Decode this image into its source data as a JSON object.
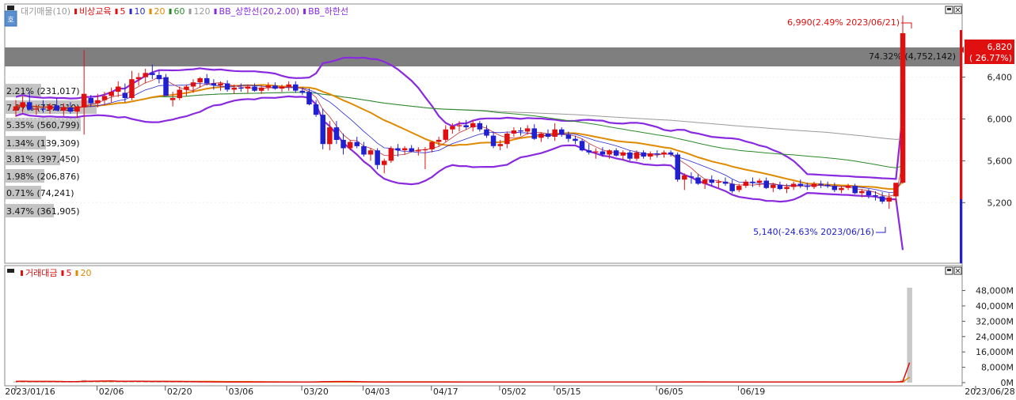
{
  "legend": {
    "top": [
      {
        "text": "대기매물(10)",
        "color": "#9a9a9a"
      },
      {
        "text": "비상교육",
        "color": "#e01010",
        "square": true
      },
      {
        "text": "5",
        "color": "#e01010",
        "square": true
      },
      {
        "text": "10",
        "color": "#2a2ad8",
        "square": true
      },
      {
        "text": "20",
        "color": "#e08a00",
        "square": true
      },
      {
        "text": "60",
        "color": "#2a8a2a",
        "square": true
      },
      {
        "text": "120",
        "color": "#9a9a9a",
        "square": true
      },
      {
        "text": "BB_상한선(20,2.00)",
        "color": "#8a2ae0",
        "square": true
      },
      {
        "text": "BB_하한선",
        "color": "#8a2ae0",
        "square": true
      }
    ],
    "bottom": [
      {
        "text": "거래대금",
        "color": "#e01010",
        "square": true
      },
      {
        "text": "5",
        "color": "#e01010",
        "square": true
      },
      {
        "text": "20",
        "color": "#e08a00",
        "square": true
      }
    ]
  },
  "main_axis": {
    "ticks": [
      "6,400",
      "6,000",
      "5,600",
      "5,200"
    ],
    "ymin": 4620,
    "ymax": 7100,
    "current_price": "6,820",
    "current_change": "( 26.77%)"
  },
  "volume_axis": {
    "ticks": [
      "48,000M",
      "40,000M",
      "32,000M",
      "24,000M",
      "16,000M",
      "8,000M",
      "0M"
    ],
    "ymax": 54000
  },
  "x_ticks": [
    "2023/01/16",
    "02/06",
    "02/20",
    "03/06",
    "03/20",
    "04/03",
    "04/17",
    "05/02",
    "05/15",
    "06/05",
    "06/19",
    "2023/06/28"
  ],
  "annotations": {
    "high": "6,990(2.49% 2023/06/21)",
    "low": "5,140(-24.63% 2023/06/16)",
    "band_label": "74.32% (4,752,142)"
  },
  "volume_profile": [
    {
      "label": "2.21% (231,017)"
    },
    {
      "label": "7.07% (737,210)"
    },
    {
      "label": "5.35% (560,799)"
    },
    {
      "label": "1.34% (139,309)"
    },
    {
      "label": "3.81% (397,450)"
    },
    {
      "label": "1.98% (206,876)"
    },
    {
      "label": "0.71% (74,241)"
    },
    {
      "label": "3.47% (361,905)"
    }
  ],
  "chart_data": {
    "type": "candlestick",
    "title": "비상교육",
    "ylim": [
      4620,
      7100
    ],
    "current": 6820,
    "high_point": {
      "value": 6990,
      "date": "2023/06/21"
    },
    "low_point": {
      "value": 5140,
      "date": "2023/06/16"
    },
    "candles": [
      [
        6080,
        6180,
        6020,
        6120
      ],
      [
        6110,
        6220,
        6060,
        6160
      ],
      [
        6160,
        6260,
        6080,
        6090
      ],
      [
        6090,
        6140,
        6040,
        6100
      ],
      [
        6100,
        6180,
        6060,
        6090
      ],
      [
        6090,
        6150,
        6050,
        6130
      ],
      [
        6130,
        6200,
        6080,
        6080
      ],
      [
        6080,
        6150,
        6030,
        6110
      ],
      [
        6110,
        6160,
        6050,
        6070
      ],
      [
        6070,
        6120,
        6010,
        6120
      ],
      [
        6110,
        6660,
        5850,
        6240
      ],
      [
        6200,
        6230,
        6120,
        6150
      ],
      [
        6150,
        6240,
        6110,
        6180
      ],
      [
        6180,
        6260,
        6130,
        6220
      ],
      [
        6220,
        6300,
        6160,
        6260
      ],
      [
        6260,
        6360,
        6210,
        6310
      ],
      [
        6250,
        6340,
        6160,
        6200
      ],
      [
        6200,
        6460,
        6180,
        6380
      ],
      [
        6380,
        6440,
        6320,
        6400
      ],
      [
        6400,
        6480,
        6340,
        6440
      ],
      [
        6440,
        6520,
        6380,
        6420
      ],
      [
        6420,
        6460,
        6340,
        6380
      ],
      [
        6400,
        6430,
        6220,
        6220
      ],
      [
        6180,
        6260,
        6120,
        6200
      ],
      [
        6200,
        6310,
        6180,
        6280
      ],
      [
        6280,
        6330,
        6220,
        6310
      ],
      [
        6310,
        6380,
        6250,
        6350
      ],
      [
        6350,
        6400,
        6300,
        6390
      ],
      [
        6390,
        6430,
        6320,
        6340
      ],
      [
        6340,
        6380,
        6280,
        6320
      ],
      [
        6320,
        6360,
        6270,
        6340
      ],
      [
        6340,
        6370,
        6260,
        6280
      ],
      [
        6280,
        6330,
        6240,
        6300
      ],
      [
        6300,
        6340,
        6260,
        6290
      ],
      [
        6290,
        6330,
        6250,
        6310
      ],
      [
        6310,
        6340,
        6260,
        6270
      ],
      [
        6270,
        6320,
        6240,
        6300
      ],
      [
        6300,
        6350,
        6270,
        6320
      ],
      [
        6320,
        6350,
        6280,
        6290
      ],
      [
        6290,
        6330,
        6260,
        6310
      ],
      [
        6310,
        6360,
        6270,
        6330
      ],
      [
        6330,
        6360,
        6250,
        6270
      ],
      [
        6270,
        6300,
        6230,
        6250
      ],
      [
        6260,
        6290,
        6130,
        6140
      ],
      [
        6140,
        6180,
        6020,
        6040
      ],
      [
        6040,
        6100,
        5710,
        5760
      ],
      [
        5760,
        5980,
        5700,
        5920
      ],
      [
        5920,
        5980,
        5760,
        5800
      ],
      [
        5800,
        5860,
        5660,
        5720
      ],
      [
        5720,
        5800,
        5700,
        5780
      ],
      [
        5780,
        5830,
        5720,
        5740
      ],
      [
        5740,
        5780,
        5640,
        5660
      ],
      [
        5660,
        5720,
        5600,
        5700
      ],
      [
        5700,
        5720,
        5520,
        5560
      ],
      [
        5560,
        5620,
        5480,
        5600
      ],
      [
        5600,
        5740,
        5580,
        5720
      ],
      [
        5720,
        5760,
        5640,
        5700
      ],
      [
        5700,
        5740,
        5660,
        5720
      ],
      [
        5720,
        5750,
        5680,
        5690
      ],
      [
        5690,
        5730,
        5650,
        5700
      ],
      [
        5700,
        5730,
        5520,
        5710
      ],
      [
        5710,
        5790,
        5680,
        5780
      ],
      [
        5780,
        5830,
        5740,
        5800
      ],
      [
        5800,
        5940,
        5780,
        5900
      ],
      [
        5900,
        5960,
        5860,
        5930
      ],
      [
        5930,
        5980,
        5880,
        5940
      ],
      [
        5940,
        5990,
        5900,
        5920
      ],
      [
        5920,
        5990,
        5880,
        5960
      ],
      [
        5960,
        5980,
        5880,
        5900
      ],
      [
        5900,
        5940,
        5820,
        5840
      ],
      [
        5840,
        5880,
        5720,
        5740
      ],
      [
        5740,
        5800,
        5700,
        5760
      ],
      [
        5760,
        5880,
        5720,
        5860
      ],
      [
        5860,
        5920,
        5830,
        5890
      ],
      [
        5890,
        5920,
        5840,
        5880
      ],
      [
        5880,
        5940,
        5850,
        5910
      ],
      [
        5910,
        5950,
        5800,
        5810
      ],
      [
        5820,
        5870,
        5780,
        5860
      ],
      [
        5860,
        5900,
        5810,
        5830
      ],
      [
        5830,
        5960,
        5790,
        5900
      ],
      [
        5900,
        5920,
        5830,
        5850
      ],
      [
        5850,
        5880,
        5780,
        5810
      ],
      [
        5810,
        5840,
        5760,
        5790
      ],
      [
        5790,
        5810,
        5690,
        5700
      ],
      [
        5700,
        5760,
        5660,
        5680
      ],
      [
        5680,
        5720,
        5620,
        5690
      ],
      [
        5690,
        5730,
        5640,
        5660
      ],
      [
        5660,
        5710,
        5620,
        5700
      ],
      [
        5700,
        5720,
        5640,
        5650
      ],
      [
        5650,
        5700,
        5610,
        5680
      ],
      [
        5680,
        5700,
        5600,
        5620
      ],
      [
        5620,
        5700,
        5600,
        5680
      ],
      [
        5680,
        5700,
        5620,
        5640
      ],
      [
        5640,
        5690,
        5610,
        5670
      ],
      [
        5670,
        5700,
        5630,
        5660
      ],
      [
        5660,
        5700,
        5630,
        5680
      ],
      [
        5680,
        5700,
        5640,
        5660
      ],
      [
        5660,
        5680,
        5400,
        5420
      ],
      [
        5420,
        5480,
        5320,
        5460
      ],
      [
        5450,
        5490,
        5380,
        5440
      ],
      [
        5440,
        5470,
        5370,
        5380
      ],
      [
        5380,
        5430,
        5330,
        5420
      ],
      [
        5420,
        5460,
        5360,
        5390
      ],
      [
        5390,
        5420,
        5340,
        5400
      ],
      [
        5400,
        5440,
        5360,
        5380
      ],
      [
        5380,
        5420,
        5290,
        5310
      ],
      [
        5320,
        5380,
        5300,
        5360
      ],
      [
        5360,
        5420,
        5340,
        5400
      ],
      [
        5400,
        5440,
        5350,
        5390
      ],
      [
        5390,
        5430,
        5350,
        5410
      ],
      [
        5410,
        5440,
        5330,
        5340
      ],
      [
        5340,
        5390,
        5300,
        5370
      ],
      [
        5370,
        5400,
        5320,
        5330
      ],
      [
        5330,
        5380,
        5290,
        5350
      ],
      [
        5350,
        5400,
        5320,
        5380
      ],
      [
        5380,
        5420,
        5340,
        5360
      ],
      [
        5360,
        5390,
        5320,
        5350
      ],
      [
        5350,
        5400,
        5330,
        5380
      ],
      [
        5380,
        5410,
        5340,
        5370
      ],
      [
        5370,
        5400,
        5340,
        5360
      ],
      [
        5360,
        5390,
        5300,
        5320
      ],
      [
        5320,
        5360,
        5290,
        5340
      ],
      [
        5340,
        5380,
        5320,
        5360
      ],
      [
        5360,
        5380,
        5280,
        5290
      ],
      [
        5290,
        5330,
        5250,
        5310
      ],
      [
        5310,
        5330,
        5240,
        5270
      ],
      [
        5270,
        5310,
        5220,
        5260
      ],
      [
        5260,
        5300,
        5190,
        5210
      ],
      [
        5210,
        5290,
        5140,
        5250
      ],
      [
        5260,
        5380,
        5200,
        5390
      ],
      [
        5390,
        6990,
        5380,
        6820
      ]
    ],
    "volumes": [
      600,
      800,
      500,
      500,
      700,
      600,
      500,
      400,
      400,
      500,
      1400,
      900,
      700,
      600,
      800,
      700,
      600,
      900,
      600,
      500,
      500,
      600,
      800,
      500,
      400,
      400,
      400,
      400,
      400,
      300,
      300,
      300,
      300,
      300,
      300,
      300,
      300,
      300,
      300,
      300,
      300,
      300,
      300,
      400,
      500,
      800,
      600,
      500,
      500,
      400,
      400,
      300,
      300,
      400,
      300,
      400,
      300,
      300,
      300,
      300,
      300,
      300,
      300,
      400,
      300,
      300,
      300,
      300,
      300,
      300,
      300,
      300,
      300,
      300,
      300,
      300,
      300,
      300,
      300,
      300,
      300,
      300,
      300,
      300,
      300,
      300,
      300,
      300,
      300,
      300,
      300,
      300,
      300,
      300,
      300,
      300,
      300,
      500,
      400,
      400,
      300,
      300,
      300,
      300,
      300,
      300,
      300,
      300,
      300,
      300,
      300,
      300,
      300,
      300,
      300,
      300,
      300,
      300,
      300,
      300,
      300,
      300,
      300,
      300,
      300,
      300,
      300,
      300,
      300,
      500,
      1500,
      49500
    ]
  }
}
